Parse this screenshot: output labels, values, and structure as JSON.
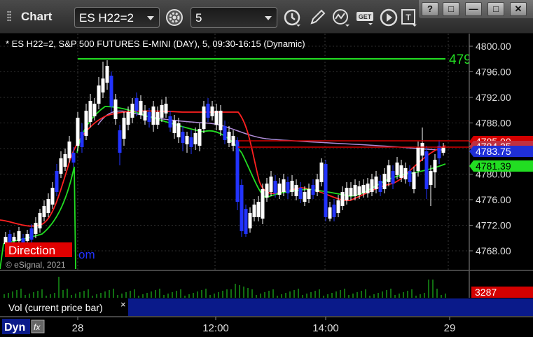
{
  "toolbar": {
    "app_title": "Chart",
    "symbol_value": "ES H22=2",
    "interval_value": "5",
    "icons": [
      "settings-icon",
      "clock-icon",
      "pencil-icon",
      "study-icon",
      "get-data-icon",
      "play-icon",
      "template-icon"
    ],
    "window_buttons": [
      "?",
      "□",
      "—",
      "□",
      "✕"
    ]
  },
  "chart": {
    "header": "* ES H22=2, S&P 500 FUTURES E-MINI (DAY), 5, 09:30-16:15 (Dynamic)",
    "copyright": "© eSignal, 2021",
    "overlay_partial": "om",
    "direction_label": "Direction",
    "line_label_partial": "479",
    "price_axis_ticks": [
      "4800.00",
      "4796.00",
      "4792.00",
      "4788.00",
      "4784.00",
      "4780.00",
      "4776.00",
      "4772.00",
      "4768.00"
    ],
    "price_badges": [
      {
        "text": "4785.00",
        "color": "#d40000",
        "text_color": "#ffffff"
      },
      {
        "text": "4784.25",
        "color": "#c03040",
        "text_color": "#ffffff"
      },
      {
        "text": "4783.75",
        "color": "#1f2fd8",
        "text_color": "#ffffff"
      },
      {
        "text": "4781.39",
        "color": "#22dd22",
        "text_color": "#000000"
      }
    ],
    "time_axis_ticks": [
      "28",
      "12:00",
      "14:00",
      "29"
    ],
    "dyn_label": "Dyn",
    "vol_label": "Vol (current price bar)",
    "vol_badge": "3287",
    "colors": {
      "up_candle": "#ffffff",
      "down_candle": "#2233ff",
      "ema_red": "#ff2020",
      "ema_green": "#22dd22",
      "ma_purple": "#b08cd8",
      "level_line": "#22dd22",
      "axis_bg": "#000000",
      "vol_pane_bg": "#0a1a8a"
    }
  }
}
